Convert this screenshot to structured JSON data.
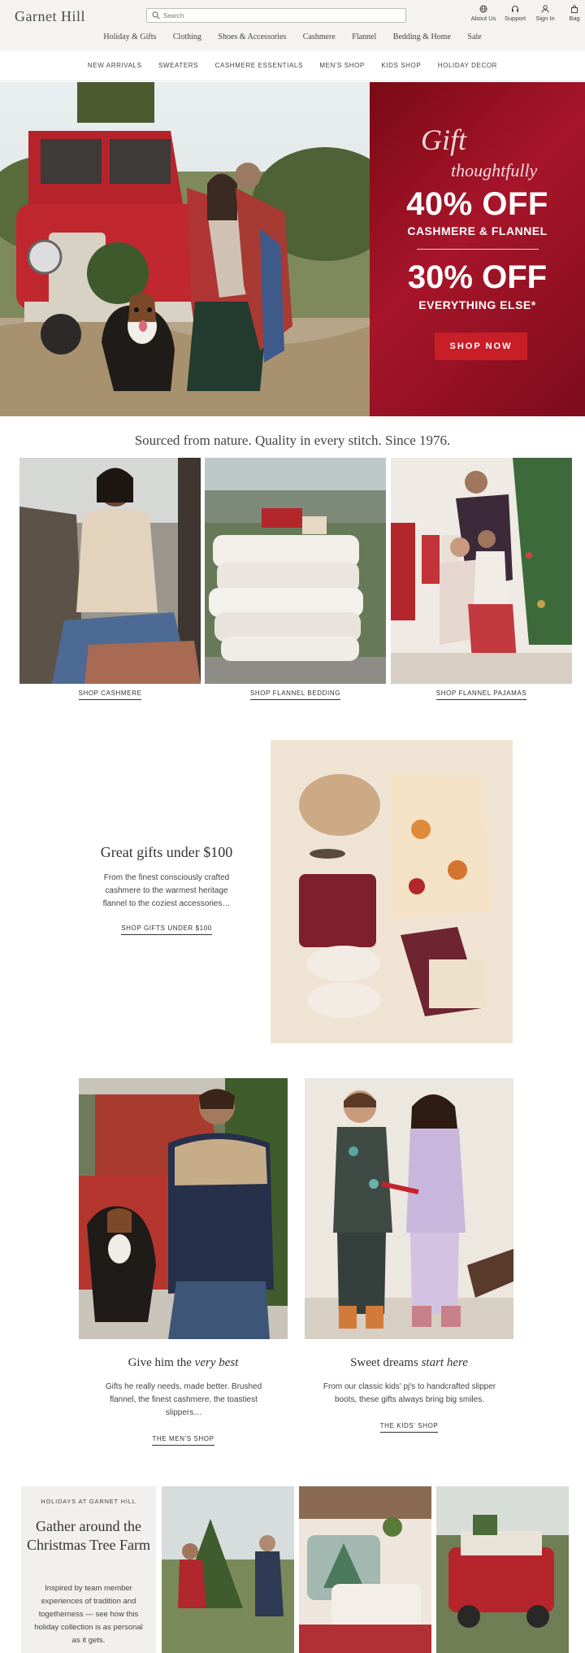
{
  "header": {
    "logo": "Garnet Hill",
    "search_placeholder": "Search",
    "utilities": [
      {
        "label": "About Us",
        "icon": "globe-icon"
      },
      {
        "label": "Support",
        "icon": "headset-icon"
      },
      {
        "label": "Sign In",
        "icon": "user-icon"
      },
      {
        "label": "Bag",
        "icon": "bag-icon"
      }
    ]
  },
  "main_nav": [
    "Holiday & Gifts",
    "Clothing",
    "Shoes & Accessories",
    "Cashmere",
    "Flannel",
    "Bedding & Home",
    "Sale"
  ],
  "sub_nav": [
    "NEW ARRIVALS",
    "SWEATERS",
    "CASHMERE ESSENTIALS",
    "MEN'S SHOP",
    "KIDS SHOP",
    "HOLIDAY DECOR"
  ],
  "hero": {
    "gift_line1": "Gift",
    "gift_line2": "thoughtfully",
    "offer1": "40% OFF",
    "offer1_sub": "CASHMERE & FLANNEL",
    "offer2": "30% OFF",
    "offer2_sub": "EVERYTHING ELSE*",
    "cta": "SHOP NOW",
    "promo_color": "#a7152a",
    "button_color": "#c81e27"
  },
  "tagline": "Sourced from nature. Quality in every stitch. Since 1976.",
  "categories": [
    {
      "label": "SHOP CASHMERE"
    },
    {
      "label": "SHOP FLANNEL BEDDING"
    },
    {
      "label": "SHOP FLANNEL PAJAMAS"
    }
  ],
  "gifts_under": {
    "title": "Great gifts under $100",
    "body": "From the finest consciously crafted cashmere to the warmest heritage flannel to the coziest accessories…",
    "cta": "SHOP GIFTS UNDER $100"
  },
  "mens": {
    "title_plain": "Give him the",
    "title_italic": "very best",
    "body": "Gifts he really needs, made better. Brushed flannel, the finest cashmere, the toastiest slippers…",
    "cta": "THE MEN'S SHOP"
  },
  "kids": {
    "title_plain": "Sweet dreams",
    "title_italic": "start here",
    "body": "From our classic kids' pj's to handcrafted slipper boots, these gifts always bring big smiles.",
    "cta": "THE KIDS' SHOP"
  },
  "farm": {
    "kicker": "HOLIDAYS AT GARNET HILL",
    "title": "Gather around the Christmas Tree Farm",
    "body": "Inspired by team member experiences of tradition and togetherness — see how this holiday collection is as personal as it gets."
  }
}
